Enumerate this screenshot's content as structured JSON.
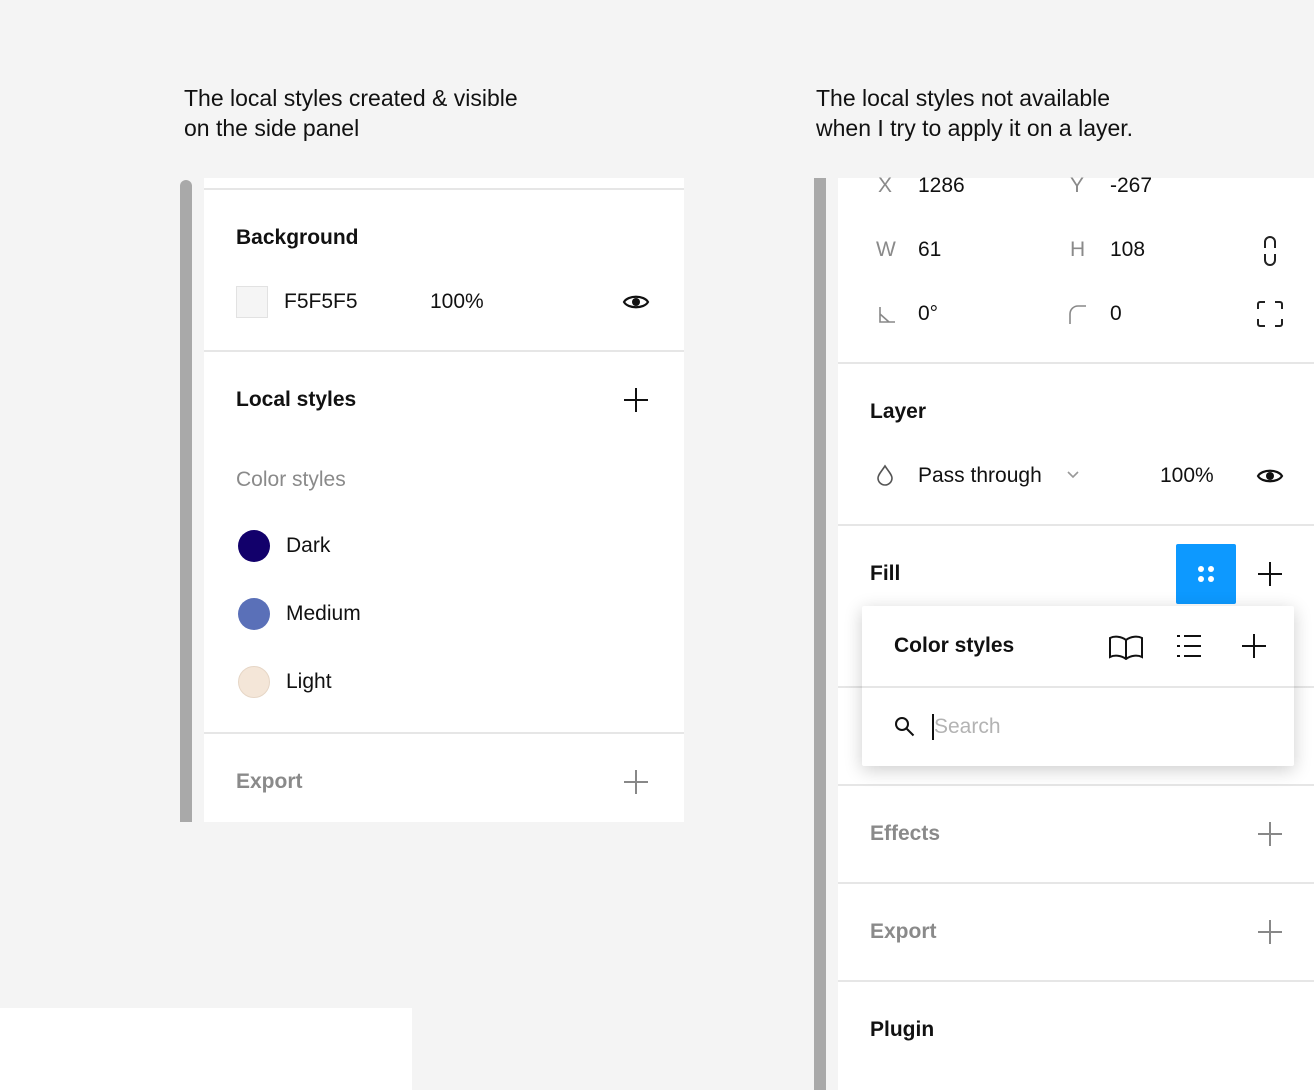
{
  "captions": {
    "left": "The local styles created & visible\non the side panel",
    "right": "The local styles not available\nwhen I try to apply it on a layer."
  },
  "left_panel": {
    "background": {
      "title": "Background",
      "hex": "F5F5F5",
      "opacity": "100%",
      "swatch": "#F5F5F5"
    },
    "local_styles": {
      "title": "Local styles",
      "group": "Color styles",
      "styles": [
        {
          "name": "Dark",
          "color": "#12006B"
        },
        {
          "name": "Medium",
          "color": "#5A70B8"
        },
        {
          "name": "Light",
          "color": "#F4E6D8"
        }
      ]
    },
    "export": {
      "title": "Export"
    }
  },
  "right_panel": {
    "transform": {
      "x_label": "X",
      "x": "1286",
      "y_label": "Y",
      "y": "-267",
      "w_label": "W",
      "w": "61",
      "h_label": "H",
      "h": "108",
      "rotation": "0°",
      "radius": "0"
    },
    "layer": {
      "title": "Layer",
      "blend": "Pass through",
      "opacity": "100%"
    },
    "fill": {
      "title": "Fill",
      "accent": "#0D99FF"
    },
    "popup": {
      "title": "Color styles",
      "search_placeholder": "Search"
    },
    "effects": {
      "title": "Effects"
    },
    "export": {
      "title": "Export"
    },
    "plugin": {
      "title": "Plugin"
    }
  }
}
